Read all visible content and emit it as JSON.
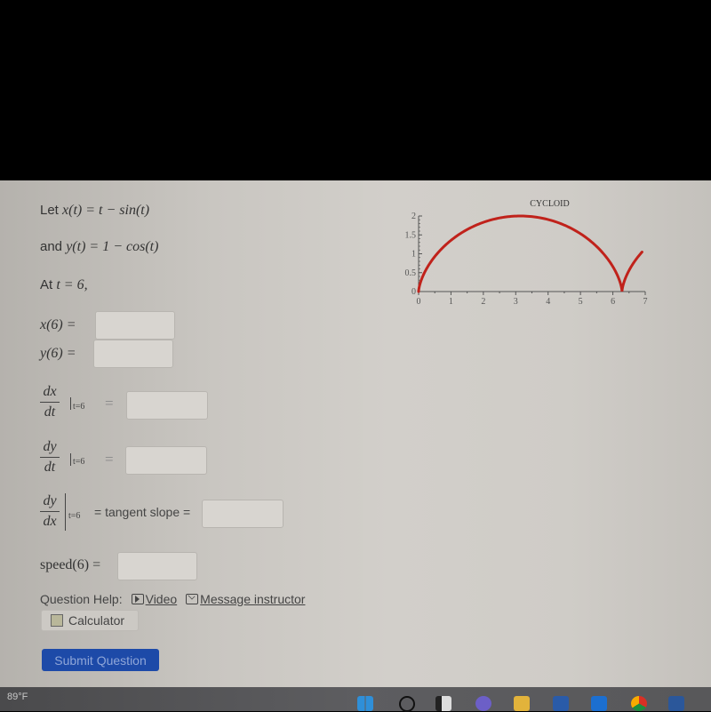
{
  "problem": {
    "line1_prefix": "Let",
    "line1_math": "x(t) = t − sin(t)",
    "line2_prefix": "and",
    "line2_math": "y(t) = 1 − cos(t)",
    "line3_prefix": "At",
    "line3_math": "t = 6,"
  },
  "fields": {
    "x6_label": "x(6) =",
    "y6_label": "y(6) =",
    "dxdt_num": "dx",
    "dxdt_den": "dt",
    "dydt_num": "dy",
    "dydt_den": "dt",
    "dydx_num": "dy",
    "dydx_den": "dx",
    "eval_at": "t=6",
    "equals": "=",
    "tangent_label": "= tangent slope =",
    "speed_label": "speed(6) =",
    "x6_value": "",
    "y6_value": "",
    "dxdt_value": "",
    "dydt_value": "",
    "dydx_value": "",
    "speed_value": ""
  },
  "help": {
    "label": "Question Help:",
    "video": "Video",
    "message": "Message instructor",
    "calculator": "Calculator"
  },
  "submit_label": "Submit Question",
  "taskbar": {
    "weather_temp": "89°F"
  },
  "chart_data": {
    "type": "line",
    "title": "CYCLOID",
    "xlabel": "",
    "ylabel": "",
    "xlim": [
      0,
      7
    ],
    "ylim": [
      0,
      2
    ],
    "xticks": [
      "0",
      "1",
      "2",
      "3",
      "4",
      "5",
      "6",
      "7"
    ],
    "yticks": [
      "0",
      "0.5",
      "1",
      "1.5",
      "2"
    ],
    "series": [
      {
        "name": "cycloid",
        "parametric": "x = t - sin(t), y = 1 - cos(t)",
        "t_range": [
          0,
          7.9
        ],
        "color": "#c0221b"
      }
    ],
    "grid": false
  }
}
